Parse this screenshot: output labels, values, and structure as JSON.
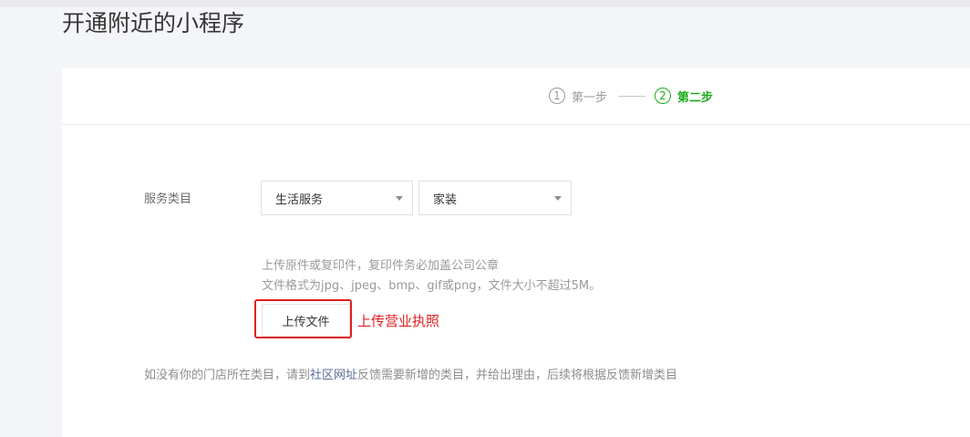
{
  "page": {
    "title": "开通附近的小程序"
  },
  "steps": [
    {
      "number": "1",
      "label": "第一步",
      "state": "done"
    },
    {
      "number": "2",
      "label": "第二步",
      "state": "active"
    }
  ],
  "form": {
    "category_label": "服务类目",
    "category_primary": "生活服务",
    "category_secondary": "家装"
  },
  "upload": {
    "tip_line1": "上传原件或复印件，复印件务必加盖公司公章",
    "tip_line2": "文件格式为jpg、jpeg、bmp、gif或png，文件大小不超过5M。",
    "button_label": "上传文件",
    "annotation": "上传营业执照"
  },
  "footer": {
    "note_before": "如没有你的门店所在类目，请到",
    "link_text": "社区网址",
    "note_after": "反馈需要新增的类目，并给出理由，后续将根据反馈新增类目"
  },
  "colors": {
    "accent_green": "#1aad19",
    "annotation_red": "#e02020",
    "link_blue": "#576b95"
  }
}
